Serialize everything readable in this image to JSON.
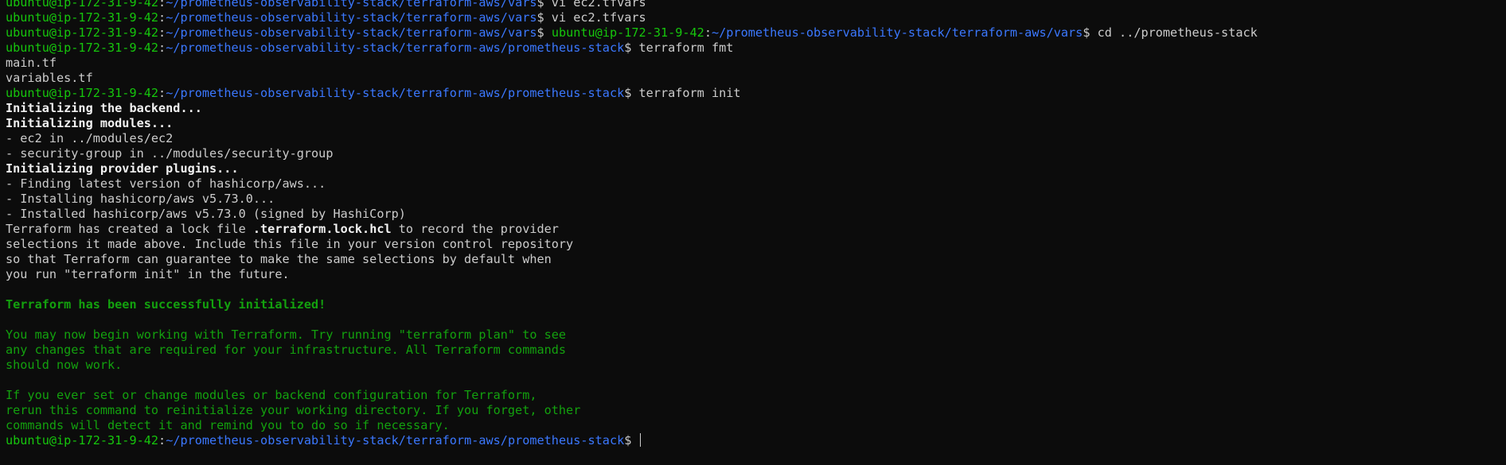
{
  "terminal": {
    "lines": [
      [
        {
          "t": "ubuntu@ip-172-31-9-42",
          "s": "prompt-user"
        },
        {
          "t": ":",
          "s": "prompt-colon"
        },
        {
          "t": "~/prometheus-observability-stack/terraform-aws/vars",
          "s": "prompt-path"
        },
        {
          "t": "$ vi ec2.tfvars",
          "s": "prompt-dollar"
        }
      ],
      [
        {
          "t": "ubuntu@ip-172-31-9-42",
          "s": "prompt-user"
        },
        {
          "t": ":",
          "s": "prompt-colon"
        },
        {
          "t": "~/prometheus-observability-stack/terraform-aws/vars",
          "s": "prompt-path"
        },
        {
          "t": "$ vi ec2.tfvars",
          "s": "prompt-dollar"
        }
      ],
      [
        {
          "t": "ubuntu@ip-172-31-9-42",
          "s": "prompt-user"
        },
        {
          "t": ":",
          "s": "prompt-colon"
        },
        {
          "t": "~/prometheus-observability-stack/terraform-aws/vars",
          "s": "prompt-path"
        },
        {
          "t": "$ ",
          "s": "prompt-dollar"
        },
        {
          "t": "ubuntu@ip-172-31-9-42",
          "s": "prompt-user"
        },
        {
          "t": ":",
          "s": "prompt-colon"
        },
        {
          "t": "~/prometheus-observability-stack/terraform-aws/vars",
          "s": "prompt-path"
        },
        {
          "t": "$ cd ../prometheus-stack",
          "s": "prompt-dollar"
        }
      ],
      [
        {
          "t": "ubuntu@ip-172-31-9-42",
          "s": "prompt-user"
        },
        {
          "t": ":",
          "s": "prompt-colon"
        },
        {
          "t": "~/prometheus-observability-stack/terraform-aws/prometheus-stack",
          "s": "prompt-path"
        },
        {
          "t": "$ terraform fmt",
          "s": "prompt-dollar"
        }
      ],
      [
        {
          "t": "main.tf",
          "s": "plain"
        }
      ],
      [
        {
          "t": "variables.tf",
          "s": "plain"
        }
      ],
      [
        {
          "t": "ubuntu@ip-172-31-9-42",
          "s": "prompt-user"
        },
        {
          "t": ":",
          "s": "prompt-colon"
        },
        {
          "t": "~/prometheus-observability-stack/terraform-aws/prometheus-stack",
          "s": "prompt-path"
        },
        {
          "t": "$ terraform init",
          "s": "prompt-dollar"
        }
      ],
      [
        {
          "t": "Initializing the backend...",
          "s": "bold"
        }
      ],
      [
        {
          "t": "Initializing modules...",
          "s": "bold"
        }
      ],
      [
        {
          "t": "- ec2 in ../modules/ec2",
          "s": "plain"
        }
      ],
      [
        {
          "t": "- security-group in ../modules/security-group",
          "s": "plain"
        }
      ],
      [
        {
          "t": "Initializing provider plugins...",
          "s": "bold"
        }
      ],
      [
        {
          "t": "- Finding latest version of hashicorp/aws...",
          "s": "plain"
        }
      ],
      [
        {
          "t": "- Installing hashicorp/aws v5.73.0...",
          "s": "plain"
        }
      ],
      [
        {
          "t": "- Installed hashicorp/aws v5.73.0 (signed by HashiCorp)",
          "s": "plain"
        }
      ],
      [
        {
          "t": "Terraform has created a lock file ",
          "s": "plain"
        },
        {
          "t": ".terraform.lock.hcl",
          "s": "bold"
        },
        {
          "t": " to record the provider",
          "s": "plain"
        }
      ],
      [
        {
          "t": "selections it made above. Include this file in your version control repository",
          "s": "plain"
        }
      ],
      [
        {
          "t": "so that Terraform can guarantee to make the same selections by default when",
          "s": "plain"
        }
      ],
      [
        {
          "t": "you run \"terraform init\" in the future.",
          "s": "plain"
        }
      ],
      [
        {
          "t": "",
          "s": "plain"
        }
      ],
      [
        {
          "t": "Terraform has been successfully initialized!",
          "s": "green-bold"
        }
      ],
      [
        {
          "t": "",
          "s": "plain"
        }
      ],
      [
        {
          "t": "You may now begin working with Terraform. Try running \"terraform plan\" to see",
          "s": "green"
        }
      ],
      [
        {
          "t": "any changes that are required for your infrastructure. All Terraform commands",
          "s": "green"
        }
      ],
      [
        {
          "t": "should now work.",
          "s": "green"
        }
      ],
      [
        {
          "t": "",
          "s": "plain"
        }
      ],
      [
        {
          "t": "If you ever set or change modules or backend configuration for Terraform,",
          "s": "green"
        }
      ],
      [
        {
          "t": "rerun this command to reinitialize your working directory. If you forget, other",
          "s": "green"
        }
      ],
      [
        {
          "t": "commands will detect it and remind you to do so if necessary.",
          "s": "green"
        }
      ],
      [
        {
          "t": "ubuntu@ip-172-31-9-42",
          "s": "prompt-user"
        },
        {
          "t": ":",
          "s": "prompt-colon"
        },
        {
          "t": "~/prometheus-observability-stack/terraform-aws/prometheus-stack",
          "s": "prompt-path"
        },
        {
          "t": "$ ",
          "s": "prompt-dollar"
        }
      ]
    ],
    "colors": {
      "background": "#0c0c0c",
      "prompt_user": "#16c60c",
      "prompt_path": "#3b78ff",
      "text": "#cccccc",
      "success": "#13a10e"
    }
  }
}
